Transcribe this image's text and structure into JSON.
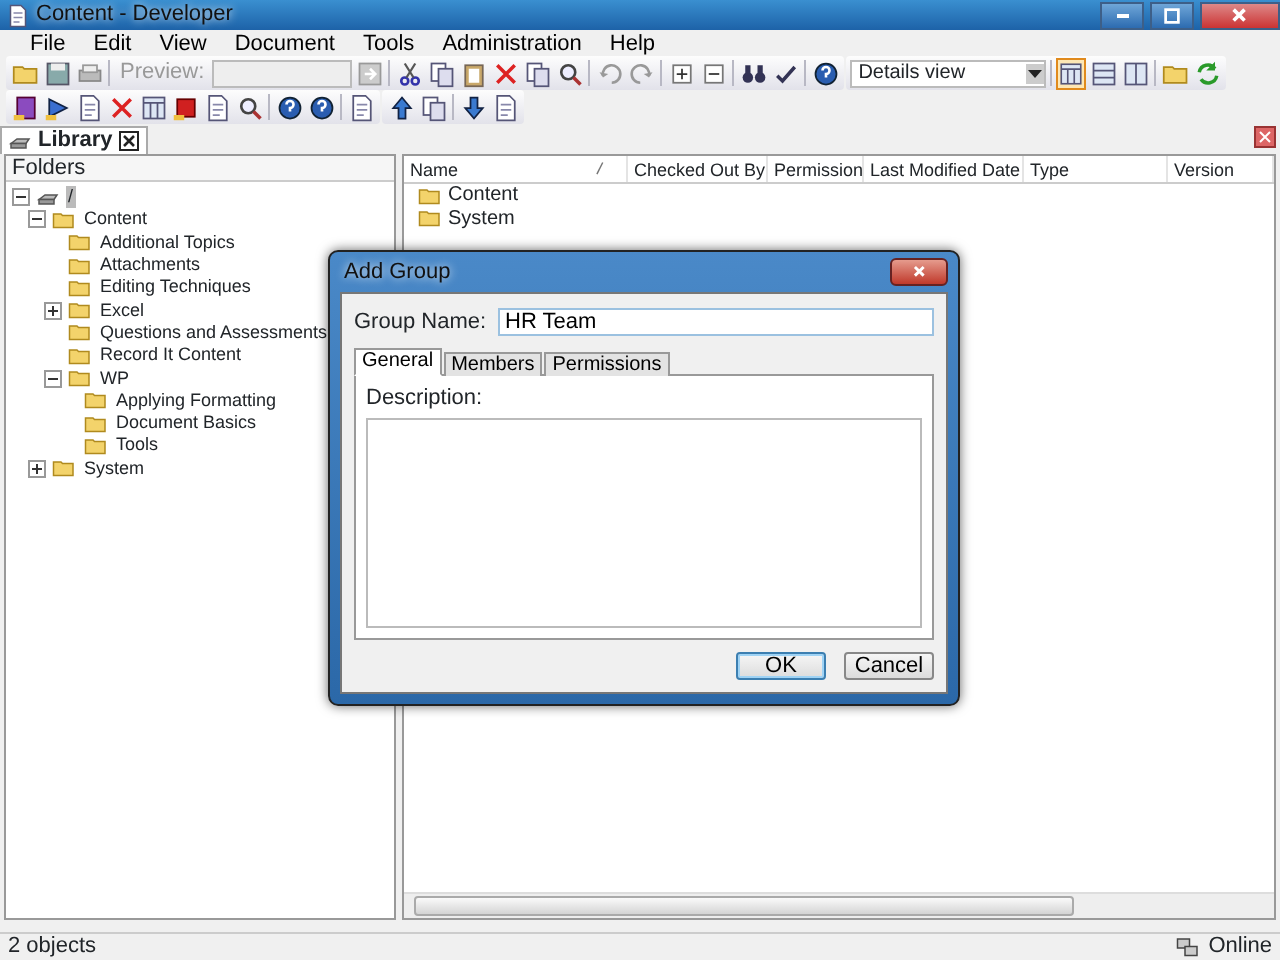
{
  "window": {
    "title": "Content - Developer"
  },
  "menu": [
    "File",
    "Edit",
    "View",
    "Document",
    "Tools",
    "Administration",
    "Help"
  ],
  "toolbar": {
    "preview_label": "Preview:",
    "preview_disabled": true,
    "view_select": {
      "value": "Details view"
    },
    "view_modes": [
      {
        "selected": true
      },
      {
        "selected": false
      },
      {
        "selected": false
      }
    ]
  },
  "tabs": [
    {
      "label": "Library",
      "selected": true
    }
  ],
  "folders": {
    "title": "Folders",
    "tree": [
      {
        "label": "/",
        "expanded": true,
        "selected": true,
        "children": [
          {
            "label": "Content",
            "expanded": true,
            "selected": false,
            "children": [
              {
                "label": "Additional Topics",
                "selected": false
              },
              {
                "label": "Attachments",
                "selected": false
              },
              {
                "label": "Editing Techniques",
                "selected": false
              },
              {
                "label": "Excel",
                "expanded": false,
                "selected": false
              },
              {
                "label": "Questions and Assessments",
                "selected": false
              },
              {
                "label": "Record It Content",
                "selected": false
              },
              {
                "label": "WP",
                "expanded": true,
                "selected": false,
                "children": [
                  {
                    "label": "Applying Formatting",
                    "selected": false
                  },
                  {
                    "label": "Document Basics",
                    "selected": false
                  },
                  {
                    "label": "Tools",
                    "selected": false
                  }
                ]
              }
            ]
          },
          {
            "label": "System",
            "expanded": false,
            "selected": false
          }
        ]
      }
    ]
  },
  "list": {
    "columns": [
      "Name",
      "Checked Out By",
      "Permission",
      "Last Modified Date",
      "Type",
      "Version"
    ],
    "rows": [
      {
        "name": "Content"
      },
      {
        "name": "System"
      }
    ]
  },
  "dialog": {
    "title": "Add Group",
    "group_name_label": "Group Name:",
    "group_name_value": "HR Team",
    "tabs": [
      {
        "label": "General",
        "selected": true
      },
      {
        "label": "Members",
        "selected": false
      },
      {
        "label": "Permissions",
        "selected": false
      }
    ],
    "description_label": "Description:",
    "buttons": [
      {
        "label": "OK",
        "default": true
      },
      {
        "label": "Cancel",
        "default": false
      }
    ]
  },
  "status_bar": {
    "left": "2 objects",
    "right": "Online"
  }
}
